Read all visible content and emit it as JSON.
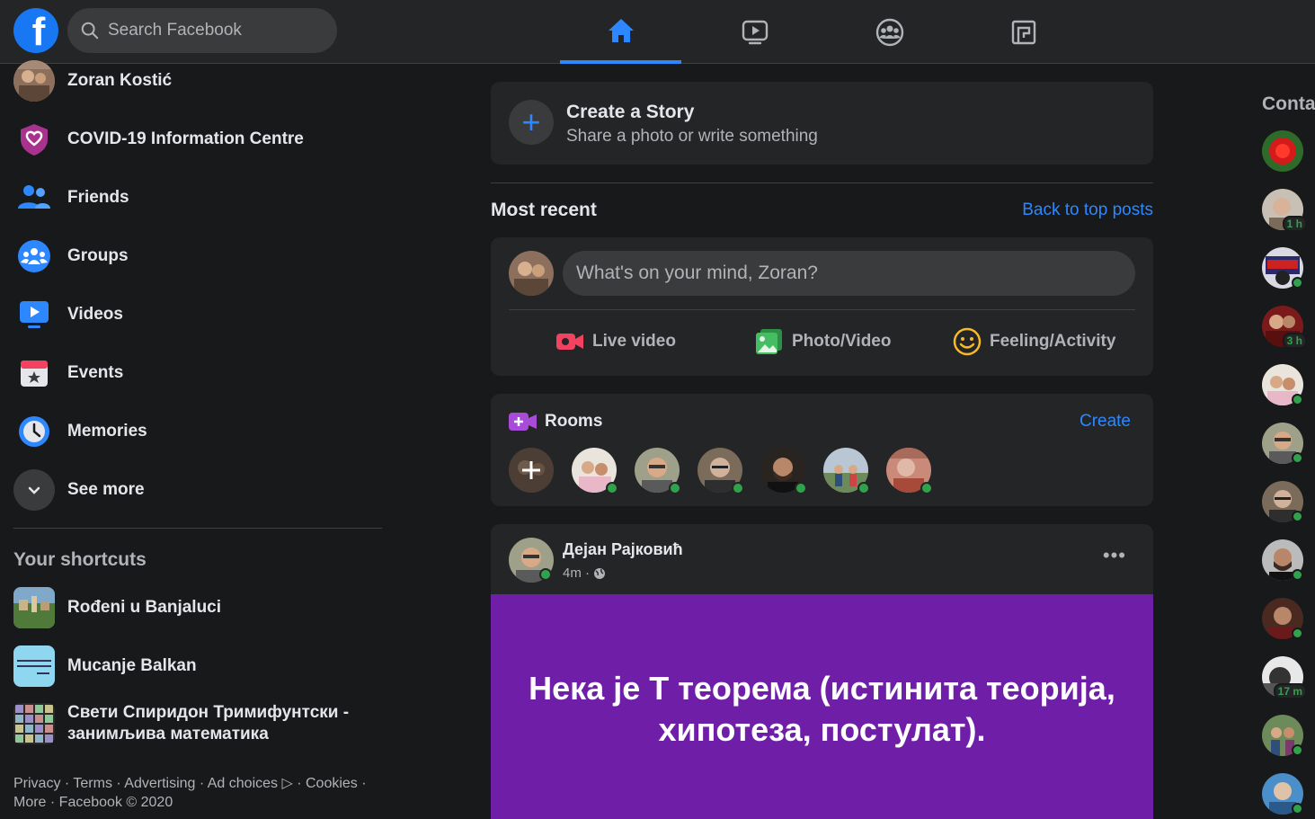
{
  "header": {
    "logo_letter": "f",
    "search_placeholder": "Search Facebook",
    "nav_tabs": [
      {
        "name": "home",
        "icon": "home-icon",
        "active": true
      },
      {
        "name": "watch",
        "icon": "watch-icon",
        "active": false
      },
      {
        "name": "groups",
        "icon": "groups-icon",
        "active": false
      },
      {
        "name": "gaming",
        "icon": "gaming-icon",
        "active": false
      }
    ]
  },
  "sidebar": {
    "items": [
      {
        "label": "Zoran Kostić",
        "icon": "profile-avatar"
      },
      {
        "label": "COVID-19 Information Centre",
        "icon": "covid-shield-icon"
      },
      {
        "label": "Friends",
        "icon": "friends-icon"
      },
      {
        "label": "Groups",
        "icon": "groups-icon"
      },
      {
        "label": "Videos",
        "icon": "videos-icon"
      },
      {
        "label": "Events",
        "icon": "events-icon"
      },
      {
        "label": "Memories",
        "icon": "memories-icon"
      },
      {
        "label": "See more",
        "icon": "chevron-down-icon"
      }
    ],
    "shortcuts_title": "Your shortcuts",
    "shortcuts": [
      {
        "label": "Rođeni u Banjaluci"
      },
      {
        "label": "Mucanje Balkan"
      },
      {
        "label": "Свети Спиридон Тримифунтски - занимљива математика"
      }
    ],
    "footer": "Privacy · Terms · Advertising · Ad choices ▷ · Cookies · More · Facebook © 2020"
  },
  "feed": {
    "story": {
      "title": "Create a Story",
      "subtitle": "Share a photo or write something"
    },
    "most_recent": "Most recent",
    "back_to_top": "Back to top posts",
    "composer": {
      "placeholder": "What's on your mind, Zoran?",
      "actions": [
        {
          "label": "Live video",
          "color": "#f3425f"
        },
        {
          "label": "Photo/Video",
          "color": "#45bd62"
        },
        {
          "label": "Feeling/Activity",
          "color": "#f7b928"
        }
      ]
    },
    "rooms": {
      "title": "Rooms",
      "create": "Create"
    },
    "post": {
      "author": "Дејан Рајковић",
      "time": "4m ·",
      "text": "Нека је Т теорема (истинита теорија, хипотеза, постулат).",
      "bg_color": "#6f1fa7"
    }
  },
  "contacts": {
    "title": "Contacts",
    "items": [
      {
        "badge": ""
      },
      {
        "badge": "1 h"
      },
      {
        "badge": ""
      },
      {
        "badge": "3 h"
      },
      {
        "badge": ""
      },
      {
        "badge": ""
      },
      {
        "badge": ""
      },
      {
        "badge": ""
      },
      {
        "badge": ""
      },
      {
        "badge": "17 m"
      },
      {
        "badge": ""
      },
      {
        "badge": ""
      }
    ]
  }
}
